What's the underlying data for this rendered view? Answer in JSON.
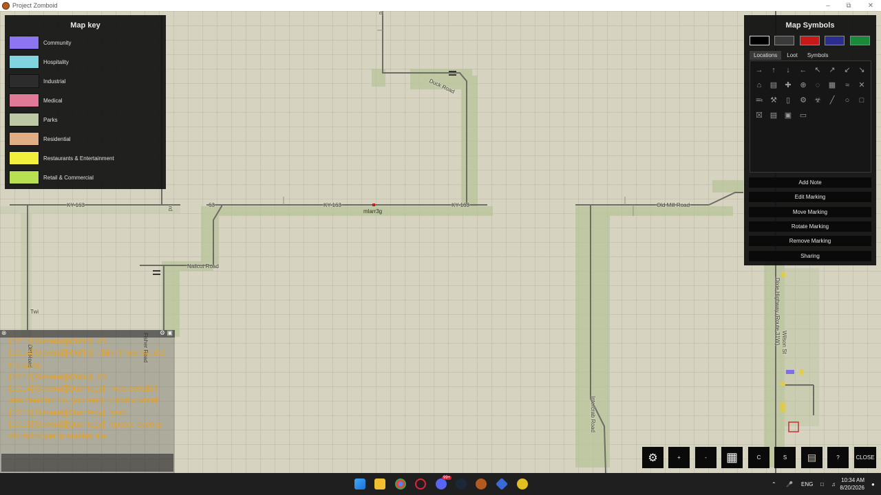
{
  "window": {
    "title": "Project Zomboid"
  },
  "map": {
    "player_name": "mlarr3g",
    "roads": {
      "ky163_a": "KY-163",
      "ky163_b": "KY-163",
      "ky163_c": "KY-163",
      "ky163_cut": "63",
      "duck_road": "Duck Road",
      "old_mill": "Old Mill Road",
      "nailcut": "Nailcut Road",
      "dixie": "Dixie Highway (Route 31W)",
      "wilson": "Wilson St",
      "intercrab": "Intercrab Road",
      "twi": "Twi",
      "road_fragment": "rd",
      "road_top": "rd",
      "fisher": "Fisher Road",
      "dirt": "Dirt Road"
    }
  },
  "map_key": {
    "title": "Map key",
    "items": [
      {
        "label": "Community",
        "color": "#8d74f0"
      },
      {
        "label": "Hospitality",
        "color": "#7fd4e0"
      },
      {
        "label": "Industrial",
        "color": "#2c2c2c"
      },
      {
        "label": "Medical",
        "color": "#e17998"
      },
      {
        "label": "Parks",
        "color": "#bcc9a4"
      },
      {
        "label": "Residential",
        "color": "#e0ad84"
      },
      {
        "label": "Restaurants & Entertainment",
        "color": "#f2ee3c"
      },
      {
        "label": "Retail & Commercial",
        "color": "#b9df52"
      }
    ]
  },
  "map_symbols": {
    "title": "Map Symbols",
    "colors": [
      "#000000",
      "#3a3a3a",
      "#c81818",
      "#2a2e8e",
      "#1a8a3a"
    ],
    "tabs": [
      "Locations",
      "Loot",
      "Symbols"
    ],
    "active_tab": "Locations",
    "actions": [
      "Add Note",
      "Edit Marking",
      "Move Marking",
      "Rotate Marking",
      "Remove Marking",
      "Sharing"
    ]
  },
  "chat": {
    "lines": [
      "[10:14][General][Wolfin]: xD",
      "[10:14][General][Wolfin]: i think those too did the same",
      "[10:14][General][Wolfin]: xD",
      "[10:14][General][Quantegy]: i was certain i was dead but no, you really outdid yourself",
      "[10:15][General][Quantegy]: tysm",
      "[10:15][General][Quantegy]: mustve been a storm trooper in another life"
    ]
  },
  "toolbar": {
    "plus": "+",
    "minus": "-",
    "c": "C",
    "s": "S",
    "help": "?",
    "close": "CLOSE"
  },
  "taskbar": {
    "lang": "ENG",
    "time": "10:34 AM",
    "date": "8/20/2026",
    "badge": "99+"
  }
}
